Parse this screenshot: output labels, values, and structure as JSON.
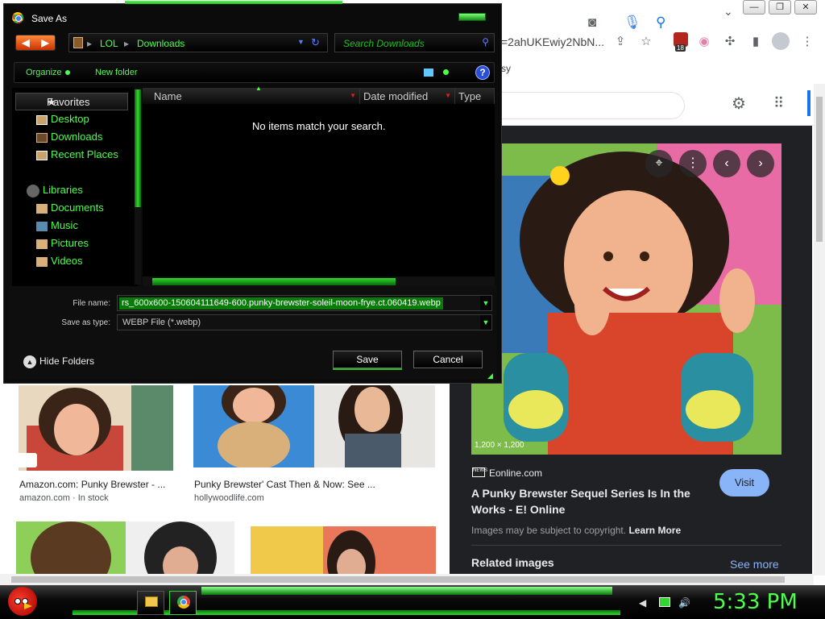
{
  "browser": {
    "url_fragment": "=2ahUKEwiy2NbN...",
    "bookmark_text": "sy",
    "ext_badge": "18",
    "tab_chevron": "⌄",
    "win_buttons": [
      "—",
      "❐",
      "✕"
    ]
  },
  "preview": {
    "resolution": "1,200 × 1,200",
    "source": "Eonline.com",
    "source_logo": "NEWS",
    "title": "A Punky Brewster Sequel Series Is In the Works - E! Online",
    "visit_label": "Visit",
    "copyright": "Images may be subject to copyright.",
    "learn_more": "Learn More",
    "related": "Related images",
    "see_more": "See more"
  },
  "thumbs": [
    {
      "caption": "Amazon.com: Punky Brewster - ...",
      "sub": "amazon.com · In stock"
    },
    {
      "caption": "Punky Brewster' Cast Then & Now: See ...",
      "sub": "hollywoodlife.com"
    }
  ],
  "dialog": {
    "title": "Save As",
    "path": [
      "LOL",
      "Downloads"
    ],
    "path_sep": "▸",
    "search_placeholder": "Search Downloads",
    "organize": "Organize",
    "new_folder": "New folder",
    "help": "?",
    "favorites_header": "Favorites",
    "favorites": [
      "Desktop",
      "Downloads",
      "Recent Places"
    ],
    "libraries_header": "Libraries",
    "libraries": [
      "Documents",
      "Music",
      "Pictures",
      "Videos"
    ],
    "columns": [
      "Name",
      "Date modified",
      "Type"
    ],
    "empty_message": "No items match your search.",
    "file_name_label": "File name:",
    "file_name_value": "rs_600x600-150604111649-600.punky-brewster-soleil-moon-frye.ct.060419.webp",
    "save_type_label": "Save as type:",
    "save_type_value": "WEBP File (*.webp)",
    "hide_folders": "Hide Folders",
    "save_label": "Save",
    "cancel_label": "Cancel"
  },
  "taskbar": {
    "clock": "5:33 PM"
  },
  "colors": {
    "accent_green": "#4cff4c",
    "dialog_bg": "#0b0b0b",
    "google_blue": "#8ab4f8",
    "panel_dark": "#202124"
  },
  "icons": [
    "chrome-icon",
    "back-arrow-icon",
    "forward-arrow-icon",
    "refresh-icon",
    "search-icon",
    "help-icon",
    "star-icon",
    "desktop-icon",
    "downloads-icon",
    "recent-places-icon",
    "libraries-icon",
    "documents-icon",
    "music-icon",
    "pictures-icon",
    "videos-icon",
    "camera-icon",
    "mic-icon",
    "gear-icon",
    "apps-grid-icon",
    "share-icon",
    "bookmark-star-icon",
    "puzzle-icon",
    "side-panel-icon",
    "profile-icon",
    "kebab-menu-icon",
    "angry-bird-start-icon",
    "folder-icon",
    "volume-icon",
    "network-icon"
  ]
}
